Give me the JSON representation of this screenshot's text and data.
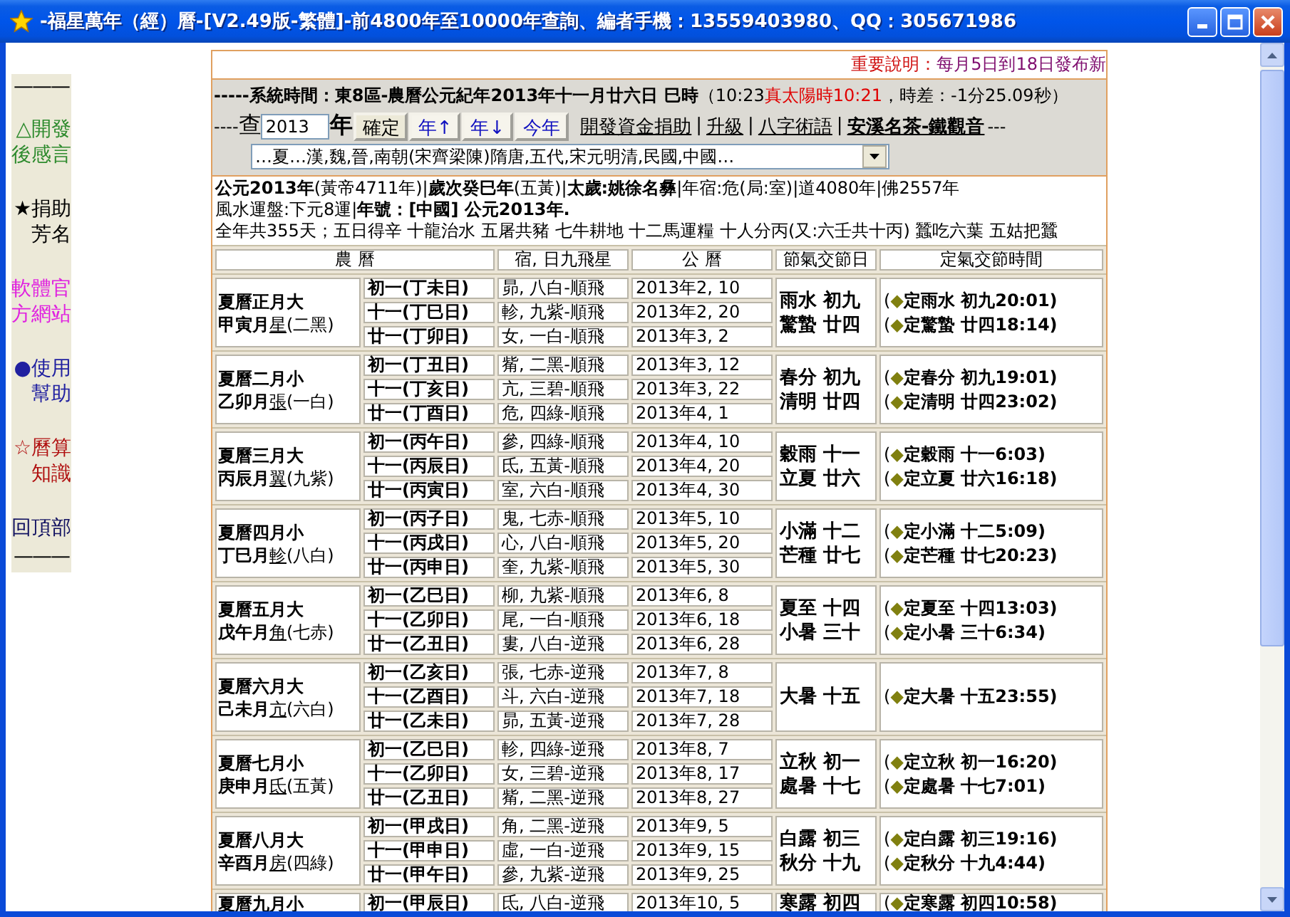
{
  "window": {
    "title": "-福星萬年（經）曆-[V2.49版-繁體]-前4800年至10000年查詢、編者手機：13559403980、QQ：305671986"
  },
  "sidebar": {
    "top_rule": "———",
    "bottom_rule": "———",
    "items": [
      {
        "label": "△開發後感言",
        "color": "#2e8b2e"
      },
      {
        "label": "★捐助芳名",
        "color": "#000000"
      },
      {
        "label": "軟體官方網站",
        "color": "#e020e0"
      },
      {
        "label": "●使用幫助",
        "color": "#2020a0"
      },
      {
        "label": "☆曆算知識",
        "color": "#b01010"
      },
      {
        "label": "回頂部",
        "color": "#101060"
      }
    ]
  },
  "notice": {
    "label": "重要說明：",
    "text": "每月5日到18日發布新"
  },
  "system_time": {
    "label": "-----系統時間：東8區-農曆公元紀年2013年十一月廿六日 巳時",
    "clock": "（10:23",
    "solar_time": "真太陽時10:21",
    "offset": "，時差：-1分25.09秒）"
  },
  "query": {
    "lead": "----",
    "search_label": "查",
    "year": "2013",
    "unit": "年",
    "confirm": "確定",
    "nav_buttons": [
      "年↑",
      "年↓",
      "今年"
    ],
    "links": [
      {
        "label": "開發資金捐助",
        "kind": "link"
      },
      {
        "label": "|",
        "kind": "separator"
      },
      {
        "label": "升級",
        "kind": "link"
      },
      {
        "label": "|",
        "kind": "separator"
      },
      {
        "label": "八字術語",
        "kind": "link"
      },
      {
        "label": "|",
        "kind": "separator"
      },
      {
        "label": "安溪名茶-鐵觀音",
        "kind": "featured"
      }
    ],
    "tail": "---"
  },
  "era_select": {
    "value": "…夏…漢,魏,晉,南朝(宋齊梁陳)隋唐,五代,宋元明清,民國,中國…"
  },
  "year_info": [
    "**公元2013年**(黃帝4711年)|**歲次癸巳年**(五黃)|**太歲:姚徐名彝**|年宿:危(局:室)|道4080年|佛2557年",
    "風水運盤:下元8運|**年號：[中國] 公元2013年.**",
    "全年共355天；五日得辛  十龍治水  五屠共豬  七牛耕地  十二馬運糧  十人分丙(又:六壬共十丙)  蠶吃六葉  五姑把蠶"
  ],
  "table": {
    "columns": [
      "農 曆",
      "宿, 日九飛星",
      "公 曆",
      "節氣交節日",
      "定氣交節時間"
    ],
    "months": [
      {
        "name": "夏曆正月大",
        "ganzhi": "甲寅月",
        "mansion": "星",
        "star": "(二黑)",
        "days": [
          {
            "label": "初一(丁未日)",
            "mansion": "昴, 八白-順飛",
            "date": "2013年2, 10"
          },
          {
            "label": "十一(丁巳日)",
            "mansion": "軫, 九紫-順飛",
            "date": "2013年2, 20"
          },
          {
            "label": "廿一(丁卯日)",
            "mansion": "女, 一白-順飛",
            "date": "2013年3, 2"
          }
        ],
        "terms": [
          "雨水  初九",
          "驚蟄  廿四"
        ],
        "times": [
          {
            "open": "(",
            "mark": "◆",
            "text": "定雨水  初九20:01)"
          },
          {
            "open": "(",
            "mark": "◆",
            "text": "定驚蟄  廿四18:14)"
          }
        ]
      },
      {
        "name": "夏曆二月小",
        "ganzhi": "乙卯月",
        "mansion": "張",
        "star": "(一白)",
        "days": [
          {
            "label": "初一(丁丑日)",
            "mansion": "觜, 二黑-順飛",
            "date": "2013年3, 12"
          },
          {
            "label": "十一(丁亥日)",
            "mansion": "亢, 三碧-順飛",
            "date": "2013年3, 22"
          },
          {
            "label": "廿一(丁酉日)",
            "mansion": "危, 四綠-順飛",
            "date": "2013年4, 1"
          }
        ],
        "terms": [
          "春分  初九",
          "清明  廿四"
        ],
        "times": [
          {
            "open": "(",
            "mark": "◆",
            "text": "定春分  初九19:01)"
          },
          {
            "open": "(",
            "mark": "◆",
            "text": "定清明  廿四23:02)"
          }
        ]
      },
      {
        "name": "夏曆三月大",
        "ganzhi": "丙辰月",
        "mansion": "翼",
        "star": "(九紫)",
        "days": [
          {
            "label": "初一(丙午日)",
            "mansion": "參, 四綠-順飛",
            "date": "2013年4, 10"
          },
          {
            "label": "十一(丙辰日)",
            "mansion": "氐, 五黃-順飛",
            "date": "2013年4, 20"
          },
          {
            "label": "廿一(丙寅日)",
            "mansion": "室, 六白-順飛",
            "date": "2013年4, 30"
          }
        ],
        "terms": [
          "穀雨  十一",
          "立夏  廿六"
        ],
        "times": [
          {
            "open": "(",
            "mark": "◆",
            "text": "定穀雨  十一6:03)"
          },
          {
            "open": "(",
            "mark": "◆",
            "text": "定立夏  廿六16:18)"
          }
        ]
      },
      {
        "name": "夏曆四月小",
        "ganzhi": "丁巳月",
        "mansion": "軫",
        "star": "(八白)",
        "days": [
          {
            "label": "初一(丙子日)",
            "mansion": "鬼, 七赤-順飛",
            "date": "2013年5, 10"
          },
          {
            "label": "十一(丙戌日)",
            "mansion": "心, 八白-順飛",
            "date": "2013年5, 20"
          },
          {
            "label": "廿一(丙申日)",
            "mansion": "奎, 九紫-順飛",
            "date": "2013年5, 30"
          }
        ],
        "terms": [
          "小滿  十二",
          "芒種  廿七"
        ],
        "times": [
          {
            "open": "(",
            "mark": "◆",
            "text": "定小滿  十二5:09)"
          },
          {
            "open": "(",
            "mark": "◆",
            "text": "定芒種  廿七20:23)"
          }
        ]
      },
      {
        "name": "夏曆五月大",
        "ganzhi": "戊午月",
        "mansion": "角",
        "star": "(七赤)",
        "days": [
          {
            "label": "初一(乙巳日)",
            "mansion": "柳, 九紫-順飛",
            "date": "2013年6, 8"
          },
          {
            "label": "十一(乙卯日)",
            "mansion": "尾, 一白-順飛",
            "date": "2013年6, 18"
          },
          {
            "label": "廿一(乙丑日)",
            "mansion": "婁, 八白-逆飛",
            "date": "2013年6, 28"
          }
        ],
        "terms": [
          "夏至  十四",
          "小暑  三十"
        ],
        "times": [
          {
            "open": "(",
            "mark": "◆",
            "text": "定夏至  十四13:03)"
          },
          {
            "open": "(",
            "mark": "◆",
            "text": "定小暑  三十6:34)"
          }
        ]
      },
      {
        "name": "夏曆六月大",
        "ganzhi": "己未月",
        "mansion": "亢",
        "star": "(六白)",
        "days": [
          {
            "label": "初一(乙亥日)",
            "mansion": "張, 七赤-逆飛",
            "date": "2013年7, 8"
          },
          {
            "label": "十一(乙酉日)",
            "mansion": "斗, 六白-逆飛",
            "date": "2013年7, 18"
          },
          {
            "label": "廿一(乙未日)",
            "mansion": "昴, 五黃-逆飛",
            "date": "2013年7, 28"
          }
        ],
        "terms": [
          "大暑  十五"
        ],
        "times": [
          {
            "open": "(",
            "mark": "◆",
            "text": "定大暑  十五23:55)"
          }
        ]
      },
      {
        "name": "夏曆七月小",
        "ganzhi": "庚申月",
        "mansion": "氐",
        "star": "(五黃)",
        "days": [
          {
            "label": "初一(乙巳日)",
            "mansion": "軫, 四綠-逆飛",
            "date": "2013年8, 7"
          },
          {
            "label": "十一(乙卯日)",
            "mansion": "女, 三碧-逆飛",
            "date": "2013年8, 17"
          },
          {
            "label": "廿一(乙丑日)",
            "mansion": "觜, 二黑-逆飛",
            "date": "2013年8, 27"
          }
        ],
        "terms": [
          "立秋  初一",
          "處暑  十七"
        ],
        "times": [
          {
            "open": "(",
            "mark": "◆",
            "text": "定立秋  初一16:20)"
          },
          {
            "open": "(",
            "mark": "◆",
            "text": "定處暑  十七7:01)"
          }
        ]
      },
      {
        "name": "夏曆八月大",
        "ganzhi": "辛酉月",
        "mansion": "房",
        "star": "(四綠)",
        "days": [
          {
            "label": "初一(甲戌日)",
            "mansion": "角, 二黑-逆飛",
            "date": "2013年9, 5"
          },
          {
            "label": "十一(甲申日)",
            "mansion": "虛, 一白-逆飛",
            "date": "2013年9, 15"
          },
          {
            "label": "廿一(甲午日)",
            "mansion": "參, 九紫-逆飛",
            "date": "2013年9, 25"
          }
        ],
        "terms": [
          "白露  初三",
          "秋分  十九"
        ],
        "times": [
          {
            "open": "(",
            "mark": "◆",
            "text": "定白露  初三19:16)"
          },
          {
            "open": "(",
            "mark": "◆",
            "text": "定秋分  十九4:44)"
          }
        ]
      },
      {
        "name": "夏曆九月小",
        "days": [
          {
            "label": "初一(甲辰日)",
            "mansion": "氐, 八白-逆飛",
            "date": "2013年10, 5"
          }
        ],
        "terms": [
          "寒露  初四"
        ],
        "times": [
          {
            "open": "(",
            "mark": "◆",
            "text": "定寒露  初四10:58)"
          }
        ]
      }
    ]
  }
}
